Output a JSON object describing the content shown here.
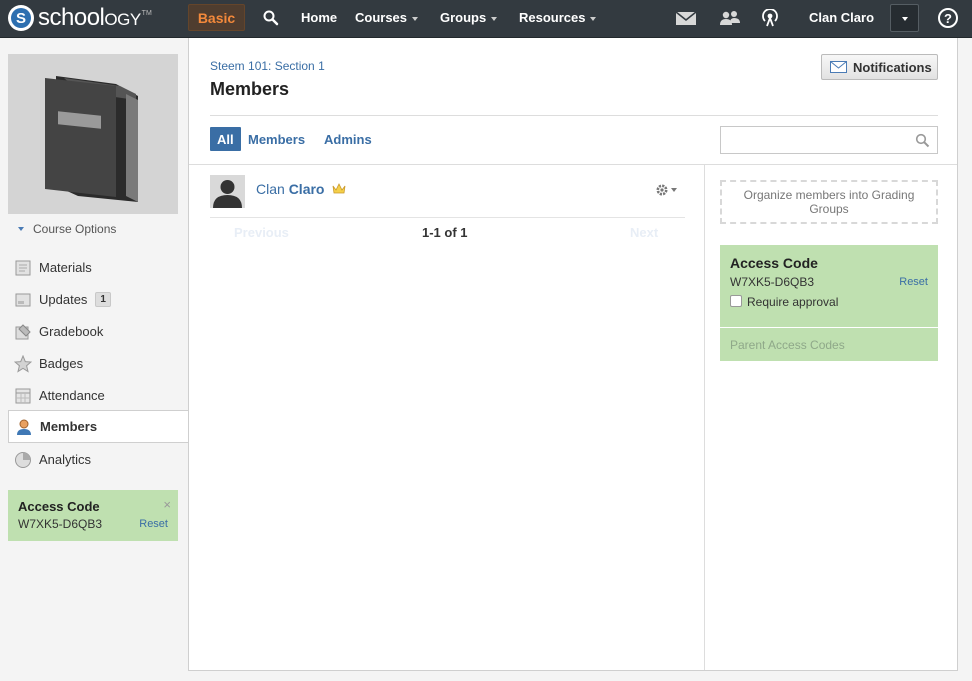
{
  "app": {
    "logo_text_a": "school",
    "logo_text_b": "ogy",
    "logo_tm": "TM",
    "basic_label": "Basic"
  },
  "topnav": {
    "home": "Home",
    "courses": "Courses",
    "groups": "Groups",
    "resources": "Resources",
    "user_name": "Clan Claro",
    "help": "?"
  },
  "sidebar": {
    "course_options": "Course Options",
    "items": [
      {
        "label": "Materials",
        "icon": "materials-icon"
      },
      {
        "label": "Updates",
        "icon": "updates-icon",
        "count": "1"
      },
      {
        "label": "Gradebook",
        "icon": "gradebook-icon"
      },
      {
        "label": "Badges",
        "icon": "badge-star-icon"
      },
      {
        "label": "Attendance",
        "icon": "attendance-icon"
      },
      {
        "label": "Members",
        "icon": "members-icon",
        "active": true
      },
      {
        "label": "Analytics",
        "icon": "analytics-pie-icon"
      }
    ],
    "access": {
      "title": "Access Code",
      "code": "W7XK5-D6QB3",
      "reset": "Reset",
      "close": "×"
    }
  },
  "main": {
    "breadcrumb": "Steem 101: Section 1",
    "title": "Members",
    "notifications_label": "Notifications",
    "tabs": [
      {
        "label": "All",
        "active": true
      },
      {
        "label": "Members"
      },
      {
        "label": "Admins"
      }
    ],
    "search": {
      "value": "",
      "placeholder": ""
    },
    "members": [
      {
        "first": "Clan",
        "last": "Claro",
        "is_admin": true
      }
    ],
    "pager": {
      "previous": "Previous",
      "count": "1-1 of 1",
      "next": "Next"
    }
  },
  "right": {
    "organize_text": "Organize members into Grading Groups",
    "access": {
      "title": "Access Code",
      "code": "W7XK5-D6QB3",
      "reset": "Reset",
      "require_approval": "Require approval",
      "require_approval_checked": false
    },
    "parent_codes": "Parent Access Codes"
  },
  "colors": {
    "topbar": "#333a40",
    "accent_blue": "#3a6ea5",
    "basic_orange": "#f3893b",
    "access_green": "#bfe0b0"
  }
}
